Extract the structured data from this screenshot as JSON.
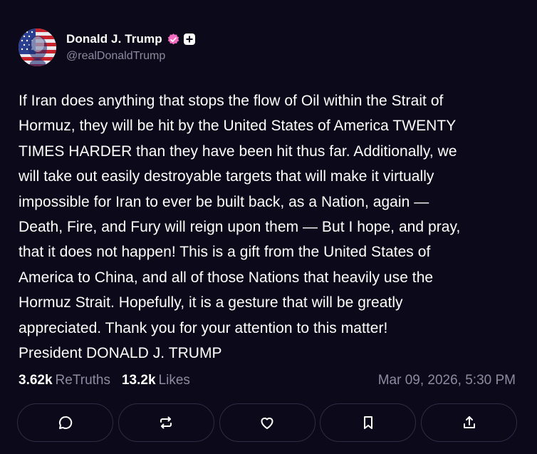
{
  "author": {
    "display_name": "Donald J. Trump",
    "handle": "@realDonaldTrump",
    "avatar_icon": "avatar-flag-portrait",
    "verified_icon": "verified-badge-icon",
    "plus_icon": "plus-badge-icon"
  },
  "post": {
    "text": "If Iran does anything that stops the flow of Oil within the Strait of\nHormuz, they will be hit by the United States of America TWENTY\nTIMES HARDER than they have been hit thus far. Additionally, we\nwill take out easily destroyable targets that will make it virtually\nimpossible for Iran to ever be built back, as a Nation, again —\nDeath, Fire, and Fury will reign upon them — But I hope, and pray,\nthat it does not happen! This is a gift from the United States of\nAmerica to China, and all of those Nations that heavily use the\nHormuz Strait. Hopefully, it is a gesture that will be greatly\nappreciated. Thank you for your attention to this matter!\nPresident DONALD J. TRUMP"
  },
  "stats": {
    "retruths_count": "3.62k",
    "retruths_label": "ReTruths",
    "likes_count": "13.2k",
    "likes_label": "Likes",
    "timestamp": "Mar 09, 2026, 5:30 PM"
  },
  "actions": [
    {
      "name": "reply",
      "icon": "comment-icon"
    },
    {
      "name": "retruth",
      "icon": "repost-icon"
    },
    {
      "name": "like",
      "icon": "heart-icon"
    },
    {
      "name": "bookmark",
      "icon": "bookmark-icon"
    },
    {
      "name": "share",
      "icon": "share-icon"
    }
  ],
  "colors": {
    "background": "#0c0a1a",
    "muted_text": "#8d8aa0",
    "verified": "#f46bc0",
    "button_border": "#2e2b45"
  }
}
